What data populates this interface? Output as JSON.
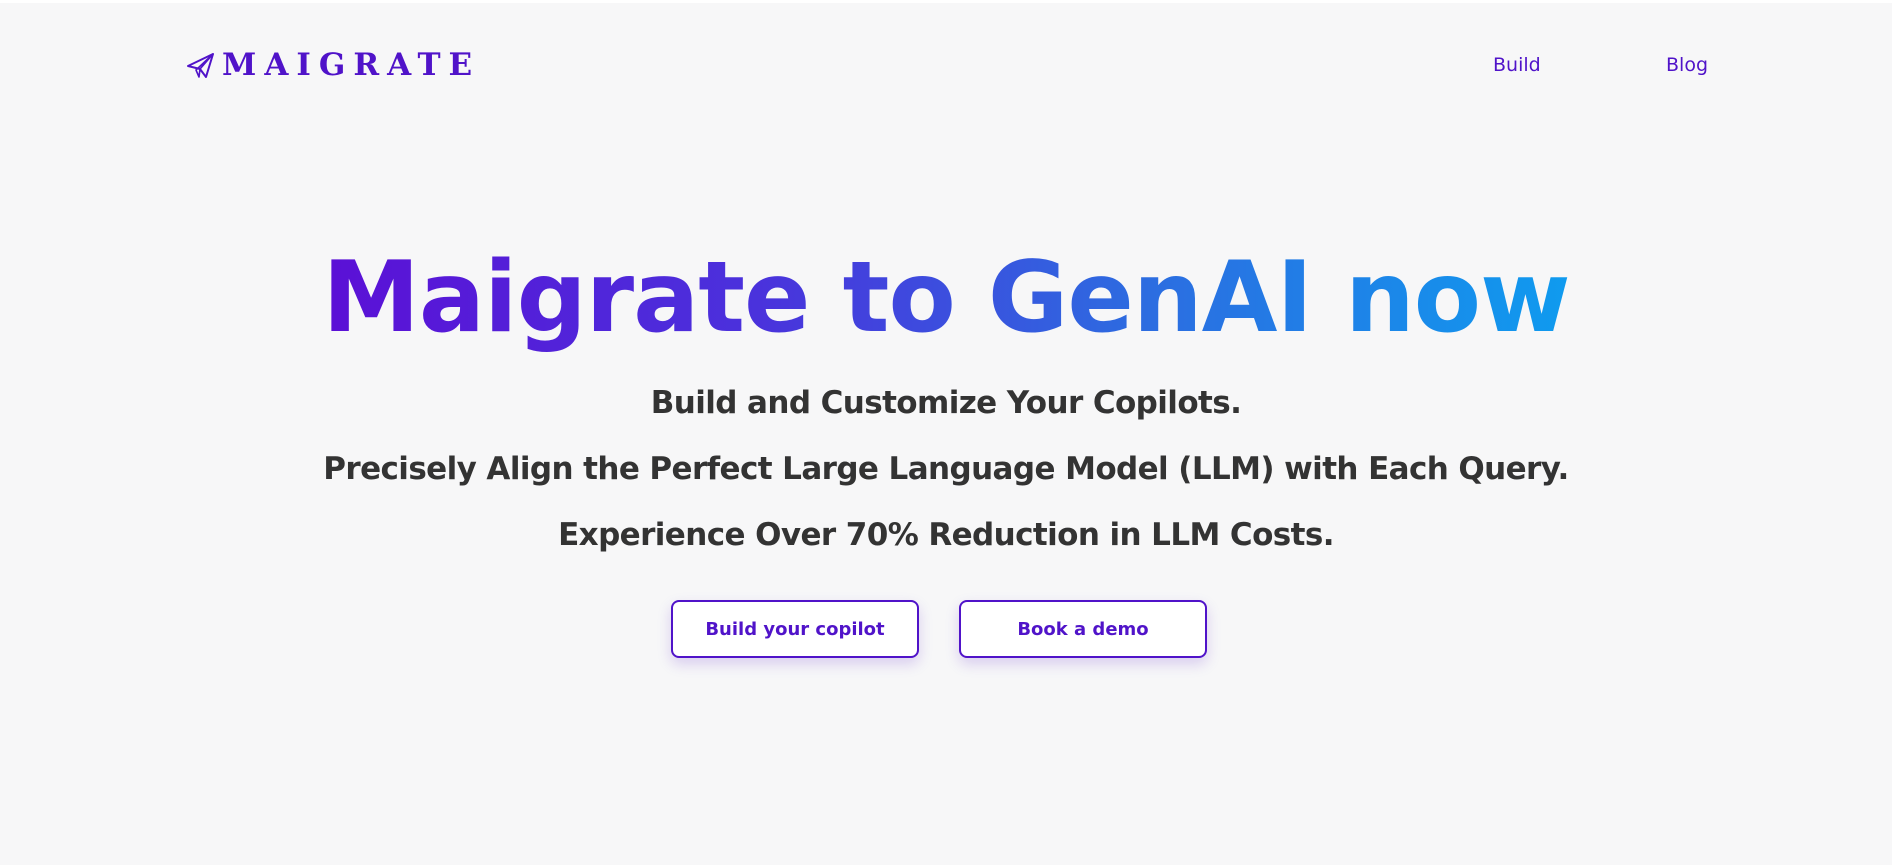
{
  "header": {
    "logo_icon": "paper-plane-icon",
    "logo_text": "MAIGRATE",
    "nav": [
      {
        "label": "Build"
      },
      {
        "label": "Blog"
      }
    ]
  },
  "hero": {
    "headline": "Maigrate to GenAI now",
    "lines": [
      "Build and Customize Your Copilots.",
      "Precisely Align the Perfect Large Language Model (LLM) with Each Query.",
      "Experience Over 70% Reduction in LLM Costs."
    ],
    "buttons": {
      "primary": "Build your copilot",
      "secondary": "Book a demo"
    }
  },
  "colors": {
    "brand": "#5013c9",
    "gradient_start": "#5b10d6",
    "gradient_end": "#0f9bef",
    "text": "#333333",
    "background": "#f7f7f8"
  }
}
